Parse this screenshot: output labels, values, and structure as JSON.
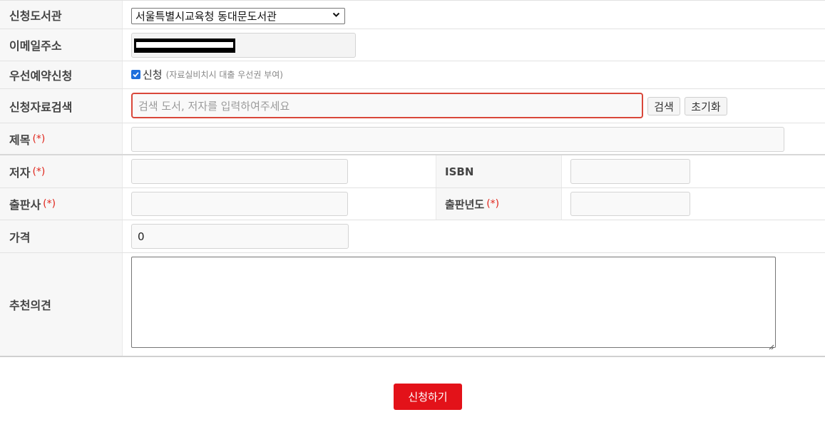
{
  "rows": {
    "library": {
      "label": "신청도서관",
      "selected": "서울특별시교육청 동대문도서관"
    },
    "email": {
      "label": "이메일주소"
    },
    "priority": {
      "label": "우선예약신청",
      "checkbox_label": "신청",
      "note": "(자료실비치시 대출 우선권 부여)"
    },
    "search": {
      "label": "신청자료검색",
      "placeholder": "검색 도서, 저자를 입력하여주세요",
      "search_button": "검색",
      "reset_button": "초기화"
    },
    "title": {
      "label": "제목",
      "required": "(*)"
    },
    "author": {
      "label": "저자",
      "required": "(*)"
    },
    "isbn": {
      "label": "ISBN"
    },
    "publisher": {
      "label": "출판사",
      "required": "(*)"
    },
    "pubyear": {
      "label": "출판년도",
      "required": "(*)"
    },
    "price": {
      "label": "가격",
      "value": "0"
    },
    "opinion": {
      "label": "추천의견"
    }
  },
  "submit_label": "신청하기",
  "colors": {
    "accent": "#e31219",
    "required": "#e0261c",
    "focus_border": "#d9473a"
  }
}
